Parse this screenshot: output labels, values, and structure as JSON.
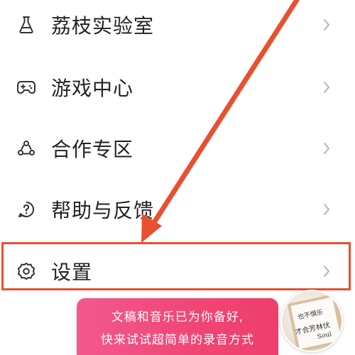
{
  "menu": {
    "items": [
      {
        "label": "荔枝实验室",
        "icon": "flask-icon"
      },
      {
        "label": "游戏中心",
        "icon": "gamepad-icon"
      },
      {
        "label": "合作专区",
        "icon": "cooperation-icon"
      },
      {
        "label": "帮助与反馈",
        "icon": "help-icon"
      },
      {
        "label": "设置",
        "icon": "gear-icon"
      }
    ],
    "chevron_icon": "chevron-right-icon"
  },
  "annotation": {
    "highlight_color": "#e8502f",
    "highlighted_item": "设置"
  },
  "banner": {
    "line1": "文稿和音乐已为你备好,",
    "line2": "快来试试超简单的录音方式"
  },
  "thumbnail": {
    "text1": "也不惧乐",
    "text2": "才合芳林伏",
    "text3": "Soul"
  }
}
